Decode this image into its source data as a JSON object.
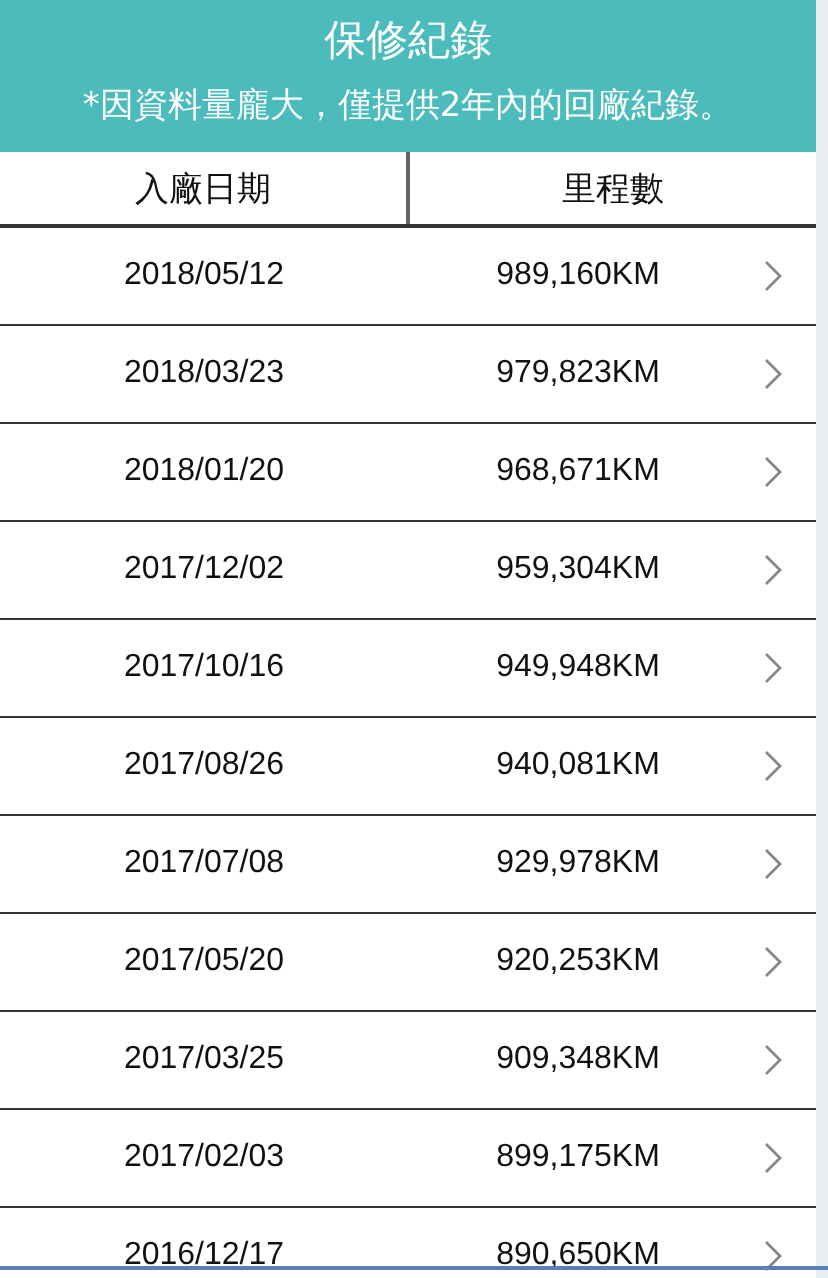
{
  "header": {
    "title": "保修紀錄",
    "notice": "*因資料量龐大，僅提供2年內的回廠紀錄。"
  },
  "table": {
    "columns": [
      "入廠日期",
      "里程數"
    ],
    "rows": [
      {
        "date": "2018/05/12",
        "mileage": "989,160KM"
      },
      {
        "date": "2018/03/23",
        "mileage": "979,823KM"
      },
      {
        "date": "2018/01/20",
        "mileage": "968,671KM"
      },
      {
        "date": "2017/12/02",
        "mileage": "959,304KM"
      },
      {
        "date": "2017/10/16",
        "mileage": "949,948KM"
      },
      {
        "date": "2017/08/26",
        "mileage": "940,081KM"
      },
      {
        "date": "2017/07/08",
        "mileage": "929,978KM"
      },
      {
        "date": "2017/05/20",
        "mileage": "920,253KM"
      },
      {
        "date": "2017/03/25",
        "mileage": "909,348KM"
      },
      {
        "date": "2017/02/03",
        "mileage": "899,175KM"
      },
      {
        "date": "2016/12/17",
        "mileage": "890,650KM"
      }
    ]
  }
}
